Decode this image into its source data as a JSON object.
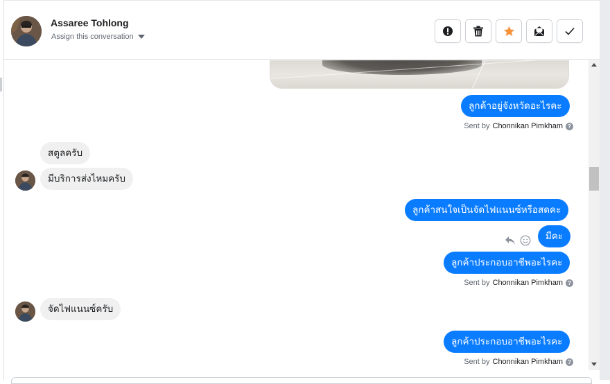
{
  "header": {
    "contact_name": "Assaree Tohlong",
    "assign_label": "Assign this conversation",
    "actions": [
      {
        "name": "spam-button",
        "icon": "alert-circle-icon"
      },
      {
        "name": "delete-button",
        "icon": "trash-icon"
      },
      {
        "name": "star-button",
        "icon": "star-icon"
      },
      {
        "name": "mark-unread-button",
        "icon": "envelope-open-icon"
      },
      {
        "name": "mark-done-button",
        "icon": "checkmark-icon"
      }
    ]
  },
  "colors": {
    "outgoing_bubble": "#0a7cff",
    "incoming_bubble": "#f0f0f0",
    "star_accent": "#f7923a"
  },
  "messages": [
    {
      "direction": "out",
      "text": "ลูกค้าอยู่จังหวัดอะไรคะ"
    },
    {
      "direction": "in",
      "text": "สตูลครับ"
    },
    {
      "direction": "in",
      "text": "มีบริการส่งไหมครับ"
    },
    {
      "direction": "out",
      "text": "ลูกค้าสนใจเป็นจัดไฟแนนซ์หรือสดคะ"
    },
    {
      "direction": "out",
      "text": "มีคะ"
    },
    {
      "direction": "out",
      "text": "ลูกค้าประกอบอาชีพอะไรคะ"
    },
    {
      "direction": "in",
      "text": "จัดไฟแนนซ์ครับ"
    },
    {
      "direction": "out",
      "text": "ลูกค้าประกอบอาชีพอะไรคะ"
    }
  ],
  "sent_by": {
    "prefix": "Sent by",
    "agent": "Chonnikan Pimkham",
    "help_glyph": "?"
  }
}
